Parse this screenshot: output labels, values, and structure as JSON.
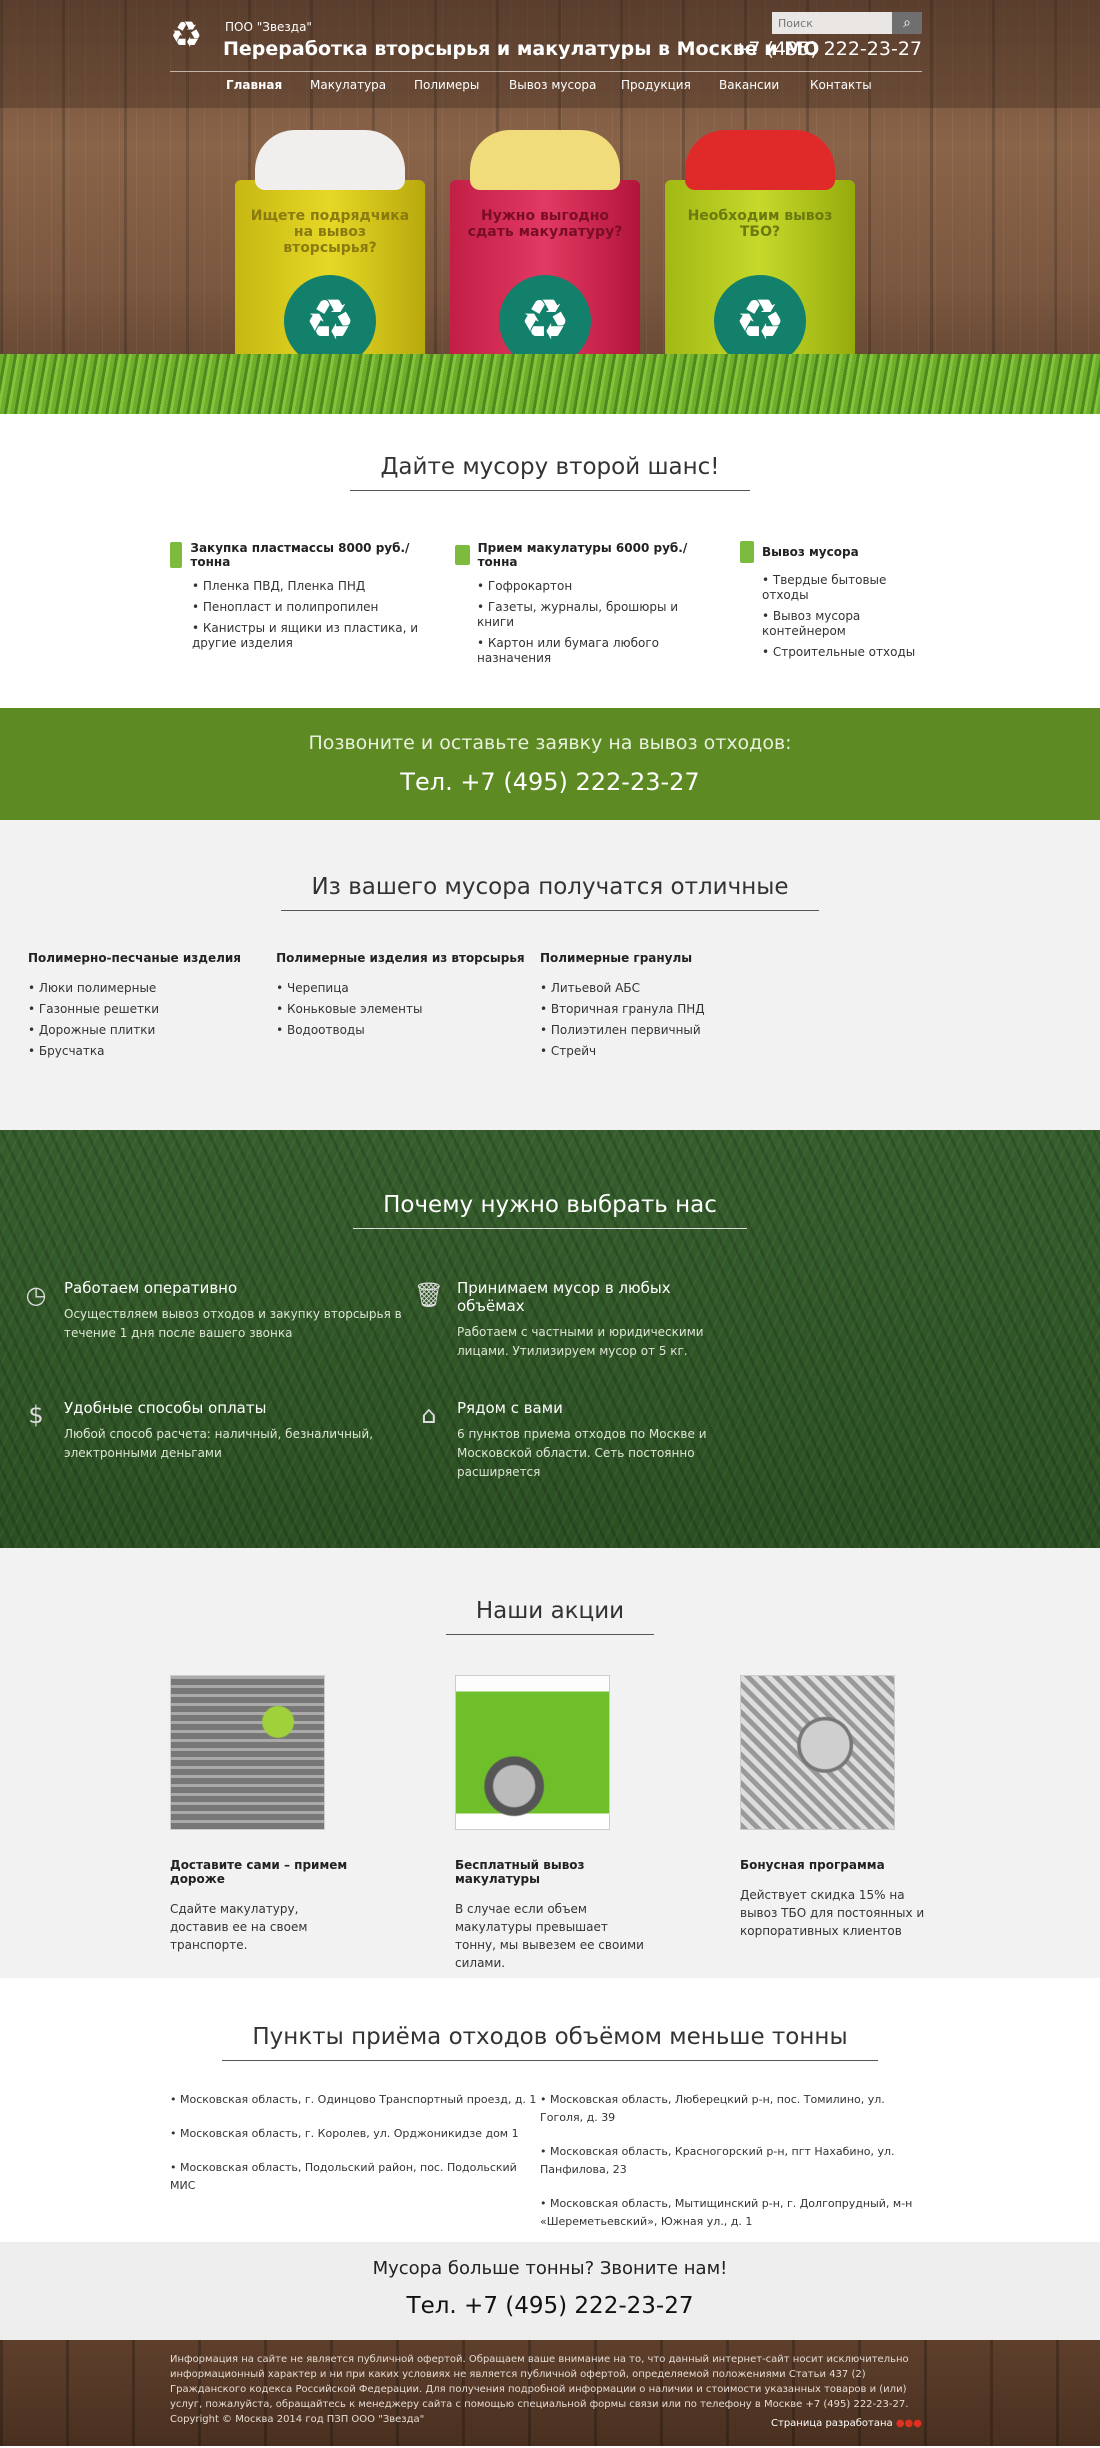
{
  "header": {
    "org": "ПОО \"Звезда\"",
    "title": "Переработка вторсырья и макулатуры в Москве и МО",
    "phone": "+7 (495) 222-23-27",
    "search_placeholder": "Поиск",
    "nav": [
      "Главная",
      "Макулатура",
      "Полимеры",
      "Вывоз мусора",
      "Продукция",
      "Вакансии",
      "Контакты"
    ]
  },
  "hero": {
    "buckets": [
      "Ищете подрядчика на вывоз вторсырья?",
      "Нужно выгодно сдать макулатуру?",
      "Необходим вывоз ТБО?"
    ]
  },
  "services": {
    "title": "Дайте мусору второй шанс!",
    "cols": [
      {
        "title": "Закупка пластмассы 8000 руб./тонна",
        "items": [
          "Пленка ПВД, Пленка ПНД",
          "Пенопласт и полипропилен",
          "Канистры и ящики из пластика, и другие изделия"
        ]
      },
      {
        "title": "Прием макулатуры 6000 руб./тонна",
        "items": [
          "Гофрокартон",
          "Газеты, журналы, брошюры и книги",
          "Картон или бумага любого назначения"
        ]
      },
      {
        "title": "Вывоз мусора",
        "items": [
          "Твердые бытовые отходы",
          "Вывоз мусора контейнером",
          "Строительные отходы"
        ]
      }
    ]
  },
  "callband": {
    "line1": "Позвоните и оставьте заявку на вывоз отходов:",
    "line2": "Тел. +7 (495) 222-23-27"
  },
  "products": {
    "title": "Из вашего мусора получатся отличные",
    "cols": [
      {
        "title": "Полимерно-песчаные изделия",
        "items": [
          "Люки полимерные",
          "Газонные решетки",
          "Дорожные плитки",
          "Брусчатка"
        ]
      },
      {
        "title": "Полимерные изделия из вторсырья",
        "items": [
          "Черепица",
          "Коньковые элементы",
          "Водоотводы"
        ]
      },
      {
        "title": "Полимерные гранулы",
        "items": [
          "Литьевой АБС",
          "Вторичная гранула ПНД",
          "Полиэтилен первичный",
          "Стрейч"
        ]
      }
    ]
  },
  "why": {
    "title": "Почему нужно выбрать нас",
    "items": [
      {
        "title": "Работаем оперативно",
        "text": "Осуществляем вывоз отходов и закупку вторсырья в течение 1 дня после вашего звонка",
        "icon": "clock-icon"
      },
      {
        "title": "Принимаем мусор в любых объёмах",
        "text": "Работаем с частными и юридическими лицами. Утилизируем мусор от 5 кг.",
        "icon": "trash-icon"
      },
      {
        "title": "Удобные способы оплаты",
        "text": "Любой способ расчета: наличный, безналичный, электронными деньгами",
        "icon": "coins-icon"
      },
      {
        "title": "Рядом с вами",
        "text": "6 пунктов приема отходов по Москве и Московской области. Сеть постоянно расширяется",
        "icon": "home-icon"
      }
    ]
  },
  "promos": {
    "title": "Наши акции",
    "items": [
      {
        "title": "Доставите сами – примем дороже",
        "text": "Сдайте макулатуру, доставив ее на своем транспорте."
      },
      {
        "title": "Бесплатный вывоз макулатуры",
        "text": "В случае если объем макулатуры превышает тонну, мы вывезем ее своими силами."
      },
      {
        "title": "Бонусная программа",
        "text": "Действует скидка 15% на вывоз ТБО для постоянных и корпоративных клиентов"
      }
    ]
  },
  "points": {
    "title": "Пункты приёма отходов объёмом меньше тонны",
    "left": [
      "Московская область, г. Одинцово Транспортный проезд, д. 1",
      "Московская область, г. Королев, ул. Орджоникидзе дом 1",
      "Московская область, Подольский район, пос. Подольский МИС"
    ],
    "right": [
      "Московская область, Люберецкий р-н, пос. Томилино, ул. Гоголя, д. 39",
      "Московская область, Красногорский р-н, пгт Нахабино, ул. Панфилова, 23",
      "Московская область, Мытищинский р-н, г. Долгопрудный, м-н «Шереметьевский», Южная ул., д. 1"
    ]
  },
  "call2": {
    "line1": "Мусора больше тонны? Звоните нам!",
    "line2": "Тел. +7 (495) 222-23-27"
  },
  "footer": {
    "text": "Информация на сайте не является публичной офертой. Обращаем ваше внимание на то, что данный интернет-сайт носит исключительно информационный характер и ни при каких условиях не является публичной офертой, определяемой положениями Статьи 437 (2) Гражданского кодекса Российской Федерации. Для получения подробной информации о наличии и стоимости указанных товаров и (или) услуг, пожалуйста, обращайтесь к менеджеру сайта с помощью специальной формы связи или по телефону в Москве +7 (495) 222-23-27. Copyright © Москва 2014 год ПЗП ООО \"Звезда\"",
    "dev": "Страница разработана"
  }
}
